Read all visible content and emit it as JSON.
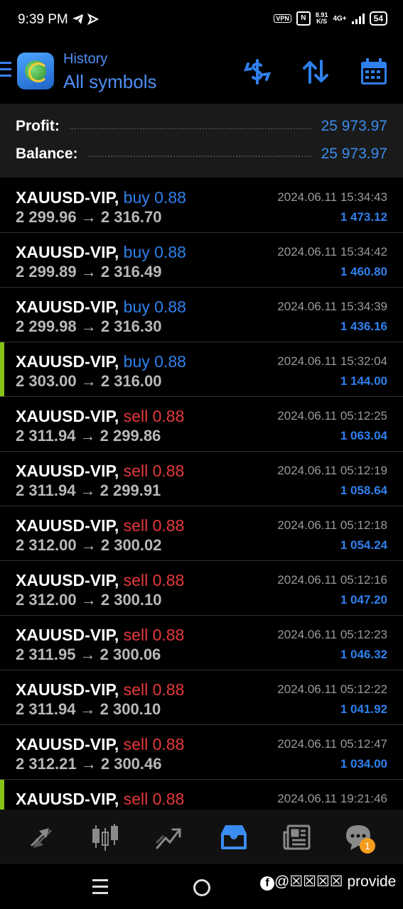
{
  "status_bar": {
    "time": "9:39 PM",
    "vpn": "VPN",
    "nfc": "N",
    "speed_value": "8.91",
    "speed_unit": "K/S",
    "network": "4G+",
    "battery": "54"
  },
  "header": {
    "subtitle": "History",
    "title": "All symbols",
    "icons": [
      "menu-icon",
      "metatrader-logo",
      "currency-exchange-icon",
      "sort-icon",
      "calendar-icon"
    ]
  },
  "summary": {
    "profit_label": "Profit:",
    "profit_value": "25 973.97",
    "balance_label": "Balance:",
    "balance_value": "25 973.97"
  },
  "trades": [
    {
      "symbol": "XAUUSD-VIP,",
      "type": "buy 0.88",
      "side": "buy",
      "prices": "2 299.96 → 2 316.70",
      "date": "2024.06.11 15:34:43",
      "profit": "1 473.12",
      "marker": false
    },
    {
      "symbol": "XAUUSD-VIP,",
      "type": "buy 0.88",
      "side": "buy",
      "prices": "2 299.89 → 2 316.49",
      "date": "2024.06.11 15:34:42",
      "profit": "1 460.80",
      "marker": false
    },
    {
      "symbol": "XAUUSD-VIP,",
      "type": "buy 0.88",
      "side": "buy",
      "prices": "2 299.98 → 2 316.30",
      "date": "2024.06.11 15:34:39",
      "profit": "1 436.16",
      "marker": false
    },
    {
      "symbol": "XAUUSD-VIP,",
      "type": "buy 0.88",
      "side": "buy",
      "prices": "2 303.00 → 2 316.00",
      "date": "2024.06.11 15:32:04",
      "profit": "1 144.00",
      "marker": true
    },
    {
      "symbol": "XAUUSD-VIP,",
      "type": "sell 0.88",
      "side": "sell",
      "prices": "2 311.94 → 2 299.86",
      "date": "2024.06.11 05:12:25",
      "profit": "1 063.04",
      "marker": false
    },
    {
      "symbol": "XAUUSD-VIP,",
      "type": "sell 0.88",
      "side": "sell",
      "prices": "2 311.94 → 2 299.91",
      "date": "2024.06.11 05:12:19",
      "profit": "1 058.64",
      "marker": false
    },
    {
      "symbol": "XAUUSD-VIP,",
      "type": "sell 0.88",
      "side": "sell",
      "prices": "2 312.00 → 2 300.02",
      "date": "2024.06.11 05:12:18",
      "profit": "1 054.24",
      "marker": false
    },
    {
      "symbol": "XAUUSD-VIP,",
      "type": "sell 0.88",
      "side": "sell",
      "prices": "2 312.00 → 2 300.10",
      "date": "2024.06.11 05:12:16",
      "profit": "1 047.20",
      "marker": false
    },
    {
      "symbol": "XAUUSD-VIP,",
      "type": "sell 0.88",
      "side": "sell",
      "prices": "2 311.95 → 2 300.06",
      "date": "2024.06.11 05:12:23",
      "profit": "1 046.32",
      "marker": false
    },
    {
      "symbol": "XAUUSD-VIP,",
      "type": "sell 0.88",
      "side": "sell",
      "prices": "2 311.94 → 2 300.10",
      "date": "2024.06.11 05:12:22",
      "profit": "1 041.92",
      "marker": false
    },
    {
      "symbol": "XAUUSD-VIP,",
      "type": "sell 0.88",
      "side": "sell",
      "prices": "2 312.21 → 2 300.46",
      "date": "2024.06.11 05:12:47",
      "profit": "1 034.00",
      "marker": false
    },
    {
      "symbol": "XAUUSD-VIP,",
      "type": "sell 0.88",
      "side": "sell",
      "prices": "",
      "date": "2024.06.11 19:21:46",
      "profit": "",
      "marker": true
    }
  ],
  "bottom_nav": {
    "items": [
      "quotes-icon",
      "chart-icon",
      "trade-icon",
      "history-icon",
      "news-icon",
      "chat-icon"
    ],
    "active": "history-icon",
    "chat_badge": "1"
  },
  "watermark": {
    "handle": "@",
    "hidden": "☒☒☒☒",
    "text": "provide"
  },
  "colors": {
    "accent": "#3b8cf0",
    "buy": "#2f80ed",
    "sell": "#e5393b",
    "marker": "#84c21a"
  }
}
